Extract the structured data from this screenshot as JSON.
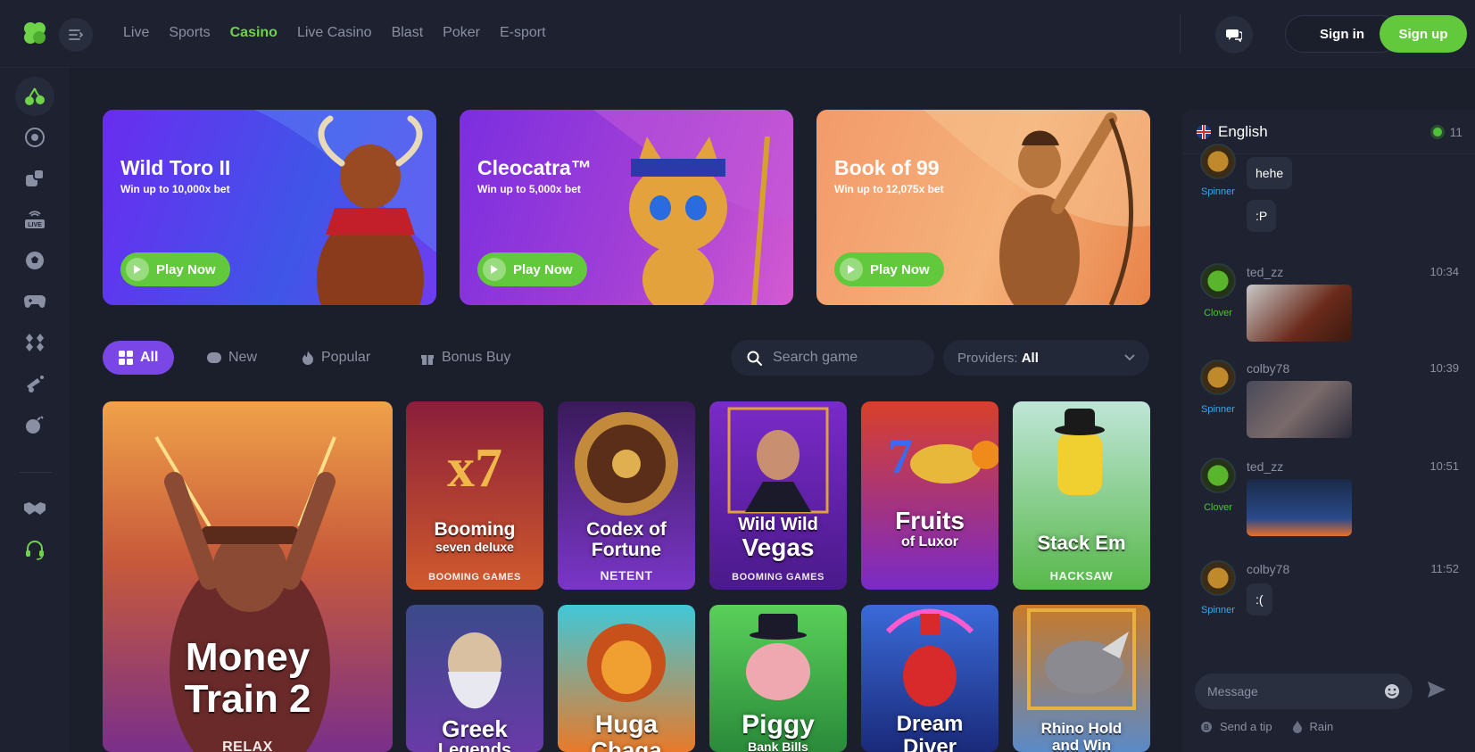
{
  "header": {
    "nav": [
      "Live",
      "Sports",
      "Casino",
      "Live Casino",
      "Blast",
      "Poker",
      "E-sport"
    ],
    "active_nav": "Casino",
    "signin_label": "Sign in",
    "signup_label": "Sign up"
  },
  "sidebar": {
    "icons": [
      "cherries-icon",
      "roulette-icon",
      "dice-icon",
      "live-icon",
      "football-icon",
      "gamepad-icon",
      "cards-icon",
      "cannon-icon",
      "bomb-icon",
      "handshake-icon",
      "support-headset-icon"
    ]
  },
  "banners": [
    {
      "title": "Wild Toro II",
      "sub_prefix": "Win up to ",
      "sub_value": "10,000x bet",
      "button": "Play Now"
    },
    {
      "title": "Cleocatra™",
      "sub_prefix": "Win up to ",
      "sub_value": "5,000x bet",
      "button": "Play Now"
    },
    {
      "title": "Book of 99",
      "sub_prefix": "Win up to ",
      "sub_value": "12,075x bet",
      "button": "Play Now"
    }
  ],
  "filters": {
    "tabs": [
      "All",
      "New",
      "Popular",
      "Bonus Buy"
    ],
    "active": "All",
    "search_placeholder": "Search game",
    "providers_label": "Providers:",
    "providers_value": "All"
  },
  "games": [
    {
      "name": "Money Train 2",
      "line1": "Money",
      "line2": "Train 2",
      "provider": "RELAX",
      "featured": true
    },
    {
      "line1": "Booming",
      "line2": "seven deluxe",
      "provider": "BOOMING GAMES"
    },
    {
      "line1": "Codex of",
      "line2": "Fortune",
      "provider": "NETENT"
    },
    {
      "line1": "Wild Wild",
      "line2": "Vegas",
      "provider": "BOOMING GAMES"
    },
    {
      "line1": "Fruits",
      "line2": "of Luxor",
      "provider": ""
    },
    {
      "line1": "Stack Em",
      "line2": "",
      "provider": "HACKSAW"
    },
    {
      "line1": "Greek",
      "line2": "Legends",
      "provider": ""
    },
    {
      "line1": "Huga",
      "line2": "Chaga",
      "provider": ""
    },
    {
      "line1": "Piggy",
      "line2": "Bank Bills",
      "provider": ""
    },
    {
      "line1": "Dream",
      "line2": "Diver",
      "provider": ""
    },
    {
      "line1": "Rhino Hold",
      "line2": "and Win",
      "provider": ""
    }
  ],
  "chat": {
    "language": "English",
    "online_count": "11",
    "messages": [
      {
        "user": "",
        "rank": "Spinner",
        "time": "",
        "text": "hehe"
      },
      {
        "user": "",
        "rank": "",
        "time": "",
        "text": ":P"
      },
      {
        "user": "ted_zz",
        "rank": "Clover",
        "time": "10:34",
        "text": ""
      },
      {
        "user": "colby78",
        "rank": "Spinner",
        "time": "10:39",
        "text": ""
      },
      {
        "user": "ted_zz",
        "rank": "Clover",
        "time": "10:51",
        "text": ""
      },
      {
        "user": "colby78",
        "rank": "Spinner",
        "time": "11:52",
        "text": ":("
      }
    ],
    "input_placeholder": "Message",
    "send_tip": "Send a tip",
    "rain": "Rain"
  },
  "colors": {
    "accent_green": "#63c93c",
    "accent_purple": "#7a46e6",
    "background": "#1b1f2b"
  }
}
